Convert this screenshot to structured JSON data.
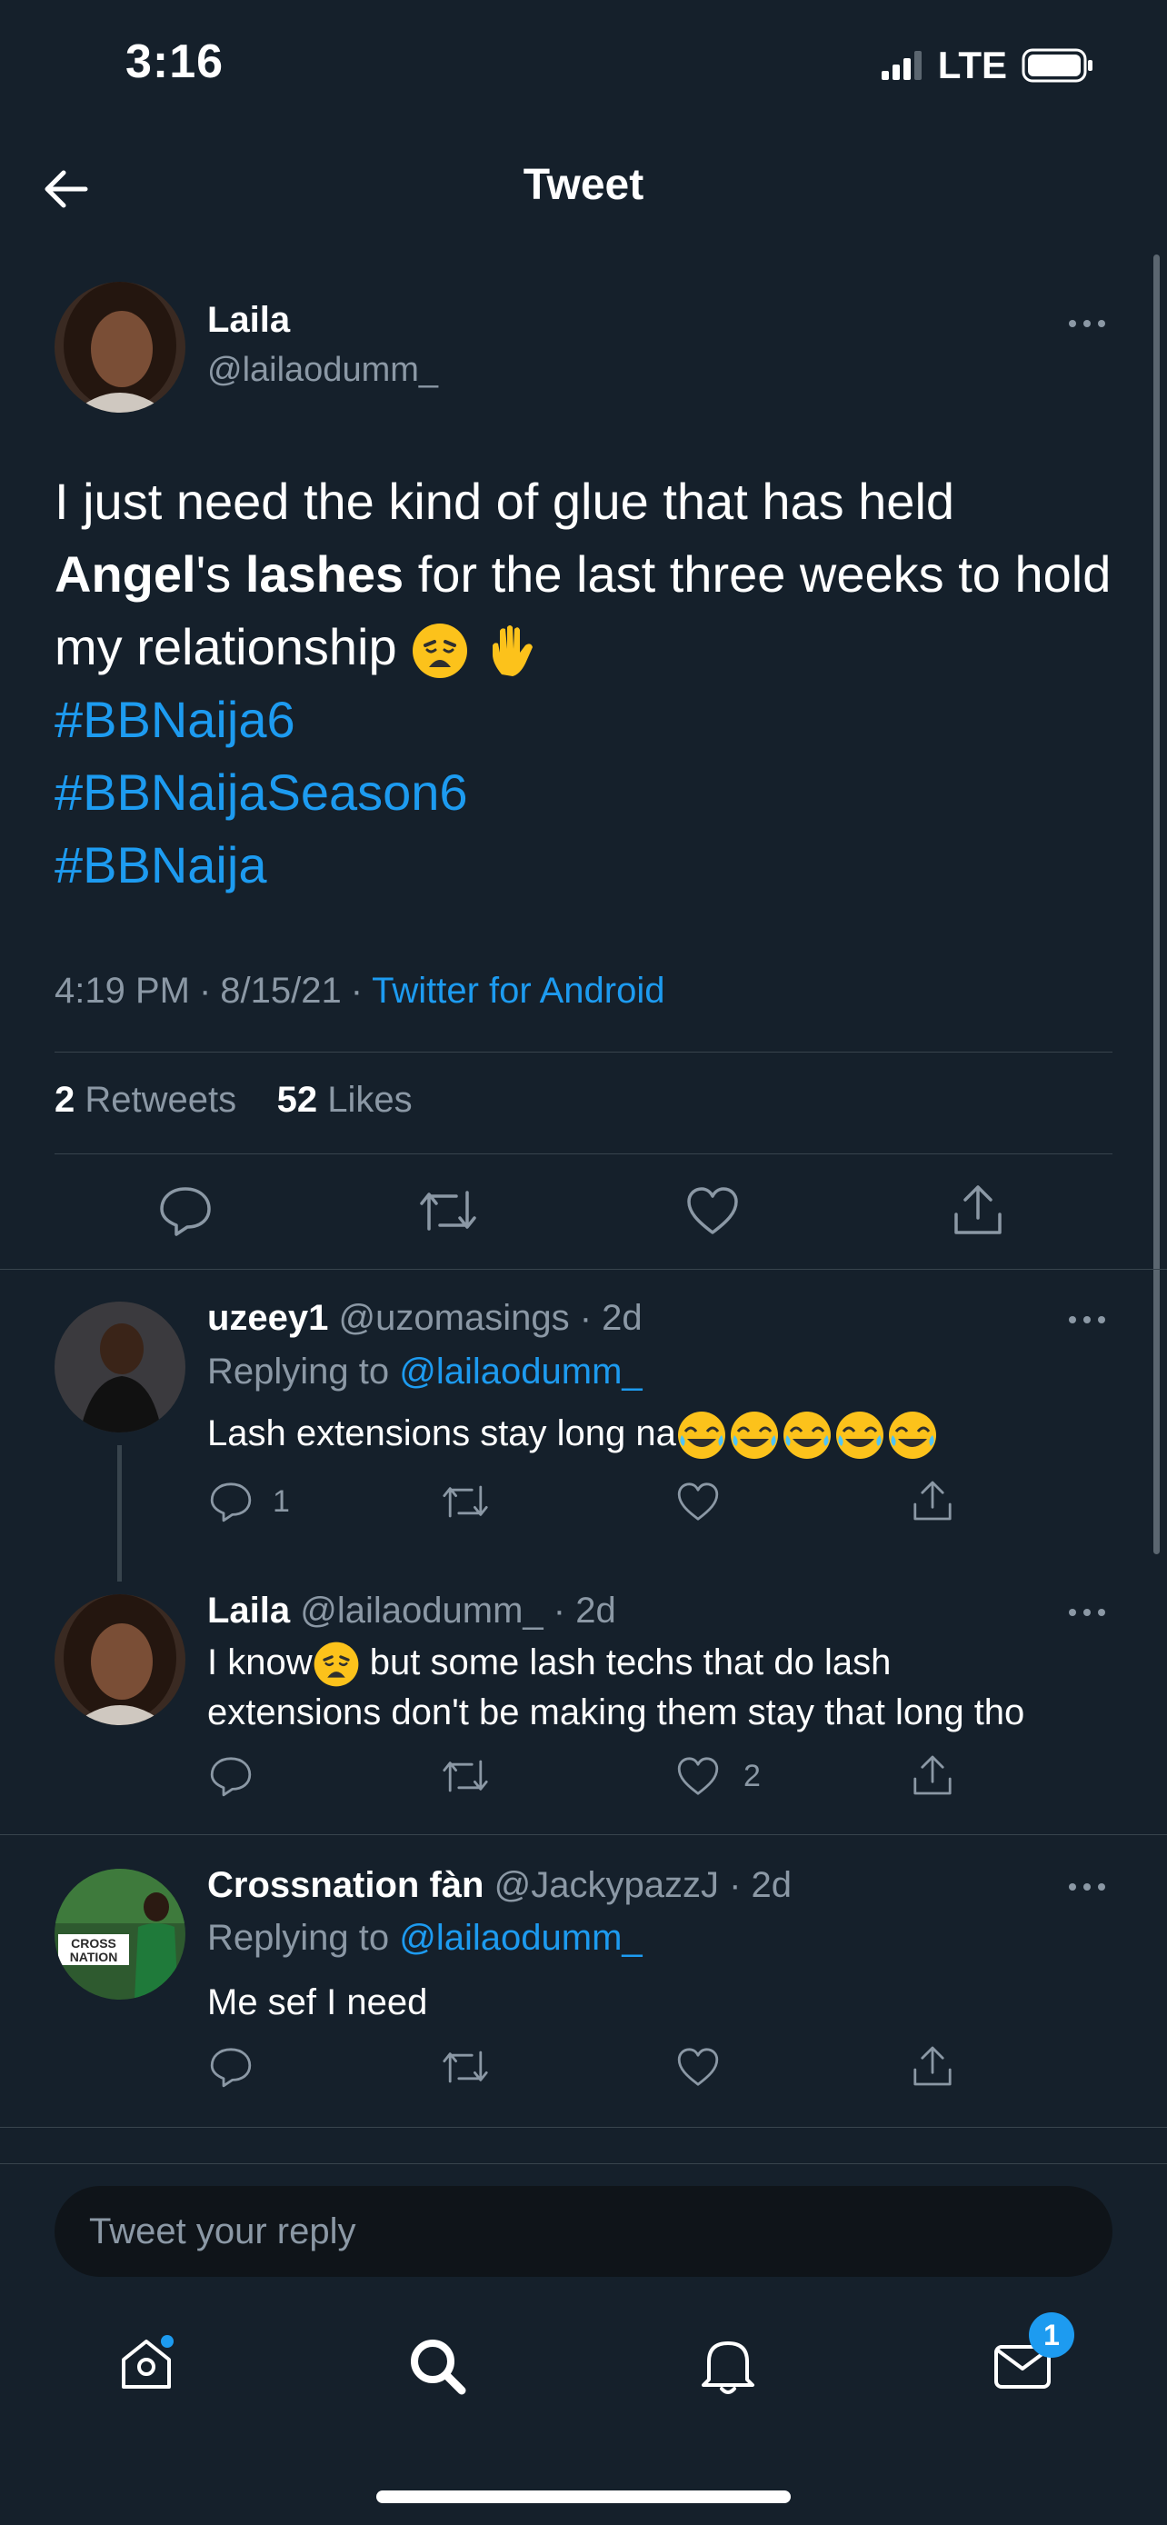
{
  "status_bar": {
    "time": "3:16",
    "network": "LTE"
  },
  "header": {
    "title": "Tweet"
  },
  "main_tweet": {
    "name": "Laila",
    "handle": "@lailaodumm_",
    "text_part1": "I just need the kind of glue that has held ",
    "bold1": "Angel",
    "text_part2": "'s ",
    "bold2": "lashes",
    "text_part3": " for the last three weeks to hold my relationship ",
    "hashtags": [
      "#BBNaija6",
      "#BBNaijaSeason6",
      "#BBNaija"
    ],
    "time": "4:19 PM",
    "date": "8/15/21",
    "source": "Twitter for Android",
    "retweets_count": "2",
    "retweets_label": "Retweets",
    "likes_count": "52",
    "likes_label": "Likes"
  },
  "replies": [
    {
      "name": "uzeey1",
      "handle": "@uzomasings",
      "age": "2d",
      "replying_label": "Replying to",
      "replying_to": "@lailaodumm_",
      "text": "Lash extensions stay long na",
      "reply_count": "1",
      "like_count": ""
    },
    {
      "name": "Laila",
      "handle": "@lailaodumm_",
      "age": "2d",
      "text_part1": "I know",
      "text_part2": " but some lash techs that do lash",
      "text_line2": "extensions don't be making them stay that long tho",
      "reply_count": "",
      "like_count": "2"
    },
    {
      "name": "Crossnation fàn",
      "handle": "@JackypazzJ",
      "age": "2d",
      "replying_label": "Replying to",
      "replying_to": "@lailaodumm_",
      "text": "Me sef I need",
      "avatar_text_1": "CROSS",
      "avatar_text_2": "NATION"
    }
  ],
  "reply_box": {
    "placeholder": "Tweet your reply"
  },
  "tabbar": {
    "messages_badge": "1"
  },
  "colors": {
    "background": "#15202b",
    "accent": "#1d9bf0",
    "muted": "#8b98a5",
    "divider": "#38444d"
  }
}
